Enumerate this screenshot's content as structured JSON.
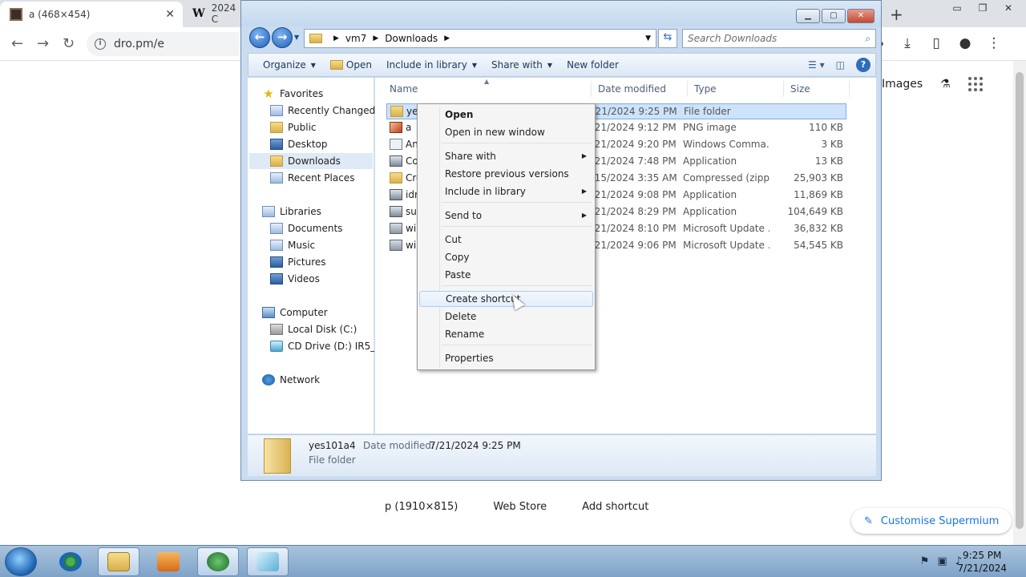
{
  "browser": {
    "tabs": [
      {
        "title": "a (468×454)"
      },
      {
        "title": "2024 C"
      }
    ],
    "url": "dro.pm/e",
    "images_link": "Images",
    "shortcuts": [
      "p (1910×815)",
      "Web Store",
      "Add shortcut"
    ],
    "customise_label": "Customise Supermium"
  },
  "explorer": {
    "breadcrumb": [
      "vm7",
      "Downloads"
    ],
    "search_placeholder": "Search Downloads",
    "commands": {
      "organize": "Organize",
      "open": "Open",
      "include_in_library": "Include in library",
      "share_with": "Share with",
      "new_folder": "New folder",
      "help": "?"
    },
    "nav": {
      "favorites": "Favorites",
      "recently_changed": "Recently Changed",
      "public": "Public",
      "desktop": "Desktop",
      "downloads": "Downloads",
      "recent_places": "Recent Places",
      "libraries": "Libraries",
      "documents": "Documents",
      "music": "Music",
      "pictures": "Pictures",
      "videos": "Videos",
      "computer": "Computer",
      "local_disk": "Local Disk (C:)",
      "cd_drive": "CD Drive (D:) IR5_CC",
      "network": "Network"
    },
    "columns": {
      "name": "Name",
      "date": "Date modified",
      "type": "Type",
      "size": "Size"
    },
    "files": [
      {
        "name": "yes",
        "date": "7/21/2024 9:25 PM",
        "type": "File folder",
        "size": ""
      },
      {
        "name": "a",
        "date": "7/21/2024 9:12 PM",
        "type": "PNG image",
        "size": "110 KB"
      },
      {
        "name": "An",
        "date": "7/21/2024 9:20 PM",
        "type": "Windows Comma...",
        "size": "3 KB"
      },
      {
        "name": "Co",
        "date": "7/21/2024 7:48 PM",
        "type": "Application",
        "size": "13 KB"
      },
      {
        "name": "Cre",
        "date": "7/15/2024 3:35 AM",
        "type": "Compressed (zipp...",
        "size": "25,903 KB"
      },
      {
        "name": "idr",
        "date": "7/21/2024 9:08 PM",
        "type": "Application",
        "size": "11,869 KB"
      },
      {
        "name": "sup",
        "date": "7/21/2024 8:29 PM",
        "type": "Application",
        "size": "104,649 KB"
      },
      {
        "name": "wir",
        "date": "7/21/2024 8:10 PM",
        "type": "Microsoft Update ...",
        "size": "36,832 KB"
      },
      {
        "name": "wir",
        "date": "7/21/2024 9:06 PM",
        "type": "Microsoft Update ...",
        "size": "54,545 KB"
      }
    ],
    "details": {
      "name": "yes101a4",
      "date_label": "Date modified:",
      "date_value": "7/21/2024 9:25 PM",
      "type": "File folder"
    }
  },
  "context_menu": {
    "open": "Open",
    "open_new_window": "Open in new window",
    "share_with": "Share with",
    "restore_previous": "Restore previous versions",
    "include_in_library": "Include in library",
    "send_to": "Send to",
    "cut": "Cut",
    "copy": "Copy",
    "paste": "Paste",
    "create_shortcut": "Create shortcut",
    "delete": "Delete",
    "rename": "Rename",
    "properties": "Properties"
  },
  "taskbar": {
    "time": "9:25 PM",
    "date": "7/21/2024"
  }
}
